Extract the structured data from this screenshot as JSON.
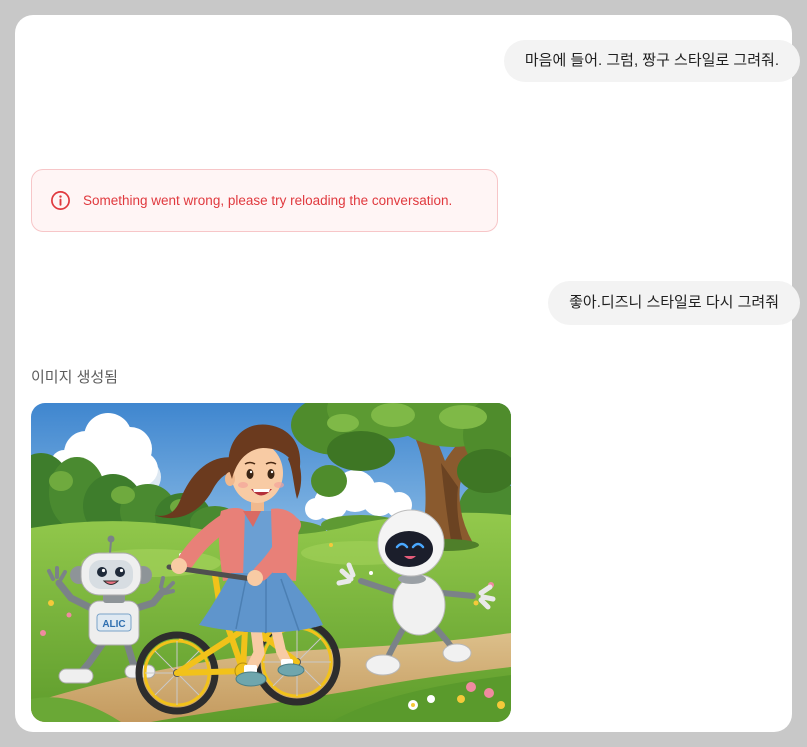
{
  "conversation": {
    "messages": [
      {
        "role": "user",
        "text": "마음에 들어. 그럼, 짱구 스타일로 그려줘."
      },
      {
        "role": "assistant",
        "type": "error",
        "icon": "info-circle-icon",
        "text": "Something went wrong, please try reloading the conversation."
      },
      {
        "role": "user",
        "text": "좋아.디즈니 스타일로 다시 그려줘"
      },
      {
        "role": "assistant",
        "type": "image",
        "status_label": "이미지 생성됨",
        "image_lettering": "ALIC"
      }
    ]
  },
  "colors": {
    "page_background": "#c8c8c8",
    "card_background": "#ffffff",
    "user_bubble": "#f3f3f3",
    "user_text": "#1f1f1f",
    "error_text": "#e0393e",
    "error_background": "#fff5f5",
    "error_border": "#f7c6c8",
    "status_label": "#5d5d5d"
  }
}
